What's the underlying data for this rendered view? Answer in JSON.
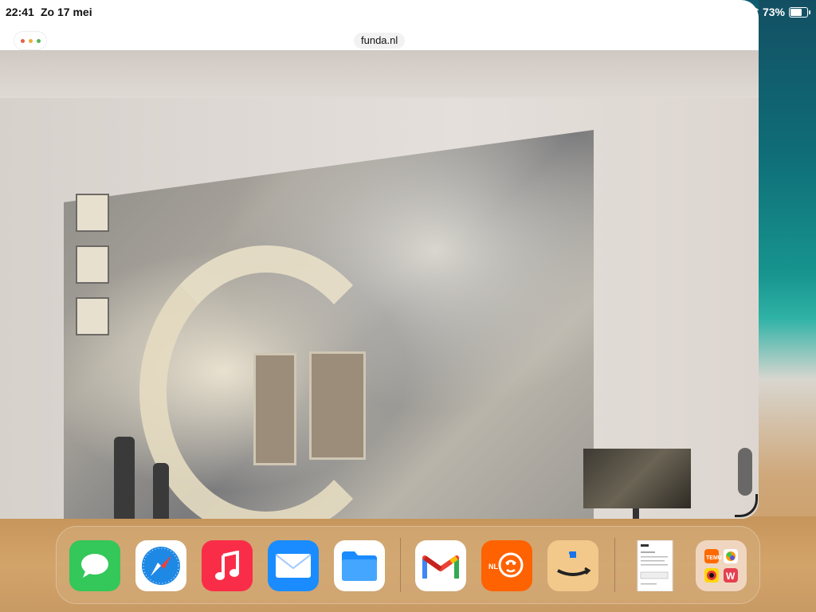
{
  "status_bar": {
    "time": "22:41",
    "date": "Zo 17 mei",
    "battery": "73%",
    "wifi_icon": "wifi-icon",
    "battery_icon": "battery-icon"
  },
  "window": {
    "url": "funda.nl",
    "dots_colors": [
      "#e5604b",
      "#e8b03a",
      "#55b45a"
    ]
  },
  "dock": {
    "apps": [
      {
        "name": "Messages",
        "icon": "messages-icon",
        "color": "#34c759"
      },
      {
        "name": "Safari",
        "icon": "safari-icon",
        "color": "#1e88e5"
      },
      {
        "name": "Music",
        "icon": "music-icon",
        "color": "#fa2d48"
      },
      {
        "name": "Mail",
        "icon": "mail-icon",
        "color": "#1a8cff"
      },
      {
        "name": "Files",
        "icon": "files-icon",
        "color": "#1a8cff"
      },
      {
        "name": "Gmail",
        "icon": "gmail-icon",
        "color": "#ea4335"
      },
      {
        "name": "ING",
        "icon": "ing-icon",
        "color": "#ff6200",
        "badge": "NL"
      },
      {
        "name": "Amazon",
        "icon": "amazon-icon",
        "color": "#f3c98b"
      },
      {
        "name": "Document",
        "icon": "document-icon",
        "color": "#ffffff"
      },
      {
        "name": "Folder",
        "icon": "folder-icon",
        "color": "#f0d6c0"
      }
    ]
  }
}
